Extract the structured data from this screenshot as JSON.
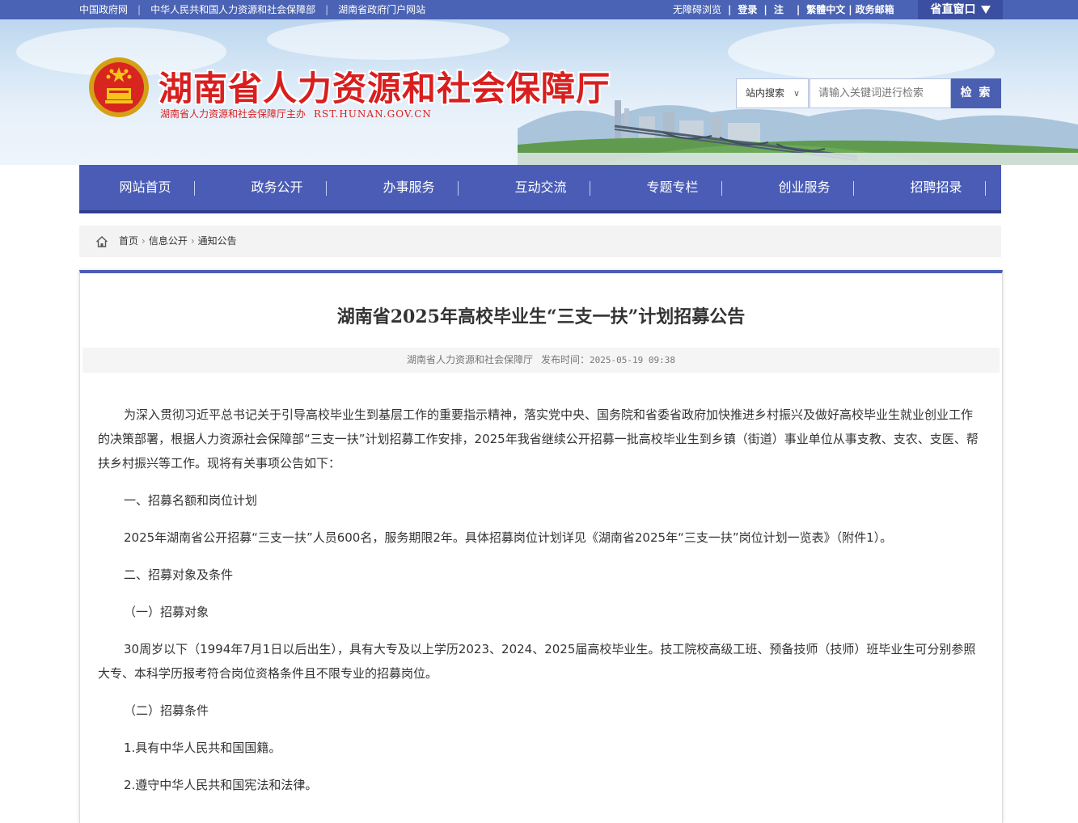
{
  "topbar": {
    "left_links": [
      "中国政府网",
      "中华人民共和国人力资源和社会保障部",
      "湖南省政府门户网站"
    ],
    "accessible": "无障碍浏览",
    "login": "登录",
    "register": "注",
    "traditional": "繁體中文",
    "email": "政务邮箱",
    "province_window": "省直窗口"
  },
  "header": {
    "title": "湖南省人力资源和社会保障厅",
    "subtitle": "湖南省人力资源和社会保障厅主办",
    "url": "RST.HUNAN.GOV.CN"
  },
  "search": {
    "scope": "站内搜索",
    "placeholder": "请输入关键词进行检索",
    "button": "检 索"
  },
  "nav": [
    "网站首页",
    "政务公开",
    "办事服务",
    "互动交流",
    "专题专栏",
    "创业服务",
    "招聘招录"
  ],
  "breadcrumb": [
    "首页",
    "信息公开",
    "通知公告"
  ],
  "article": {
    "title": "湖南省2025年高校毕业生“三支一扶”计划招募公告",
    "source": "湖南省人力资源和社会保障厅",
    "time_label": "发布时间：",
    "time": "2025-05-19 09:38",
    "paragraphs": [
      "为深入贯彻习近平总书记关于引导高校毕业生到基层工作的重要指示精神，落实党中央、国务院和省委省政府加快推进乡村振兴及做好高校毕业生就业创业工作的决策部署，根据人力资源社会保障部“三支一扶”计划招募工作安排，2025年我省继续公开招募一批高校毕业生到乡镇（街道）事业单位从事支教、支农、支医、帮扶乡村振兴等工作。现将有关事项公告如下：",
      "一、招募名额和岗位计划",
      "2025年湖南省公开招募“三支一扶”人员600名，服务期限2年。具体招募岗位计划详见《湖南省2025年“三支一扶”岗位计划一览表》（附件1）。",
      "二、招募对象及条件",
      "（一）招募对象",
      "30周岁以下（1994年7月1日以后出生），具有大专及以上学历2023、2024、2025届高校毕业生。技工院校高级工班、预备技师（技师）班毕业生可分别参照大专、本科学历报考符合岗位资格条件且不限专业的招募岗位。",
      "（二）招募条件",
      "1.具有中华人民共和国国籍。",
      "2.遵守中华人民共和国宪法和法律。"
    ]
  }
}
